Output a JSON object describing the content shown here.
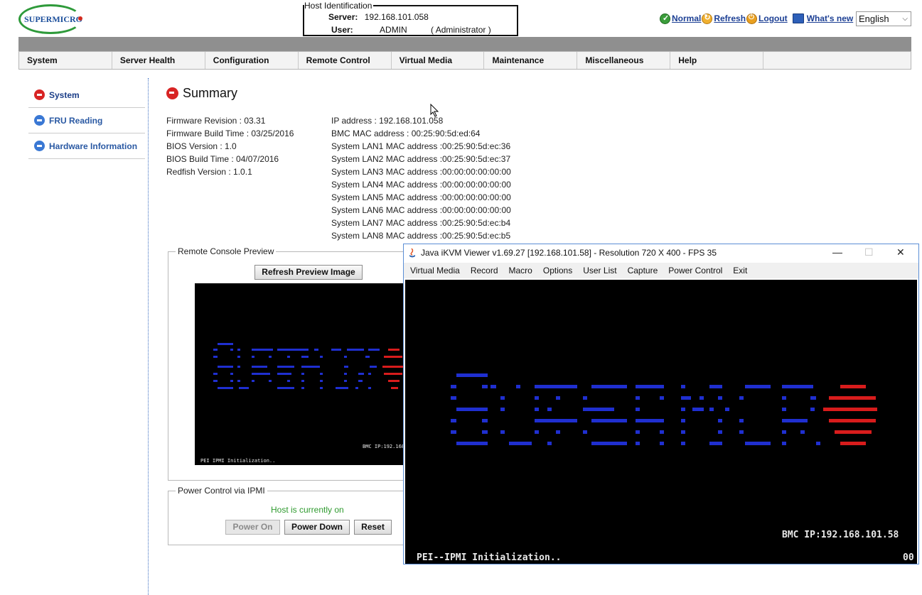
{
  "brand": {
    "logo_text": "SUPERMICRO"
  },
  "host_identification": {
    "legend": "Host Identification",
    "server_label": "Server:",
    "server_value": "192.168.101.058",
    "user_label": "User:",
    "user_value": "ADMIN",
    "user_role": "( Administrator )"
  },
  "status": {
    "normal": "Normal",
    "refresh": "Refresh",
    "logout": "Logout",
    "whats_new": "What's  new",
    "language": "English"
  },
  "nav": {
    "items": [
      "System",
      "Server Health",
      "Configuration",
      "Remote Control",
      "Virtual Media",
      "Maintenance",
      "Miscellaneous",
      "Help"
    ]
  },
  "sidebar": {
    "items": [
      {
        "label": "System",
        "active": true
      },
      {
        "label": "FRU Reading",
        "active": false
      },
      {
        "label": "Hardware Information",
        "active": false
      }
    ]
  },
  "summary": {
    "title": "Summary",
    "left_info": [
      "Firmware Revision :  03.31",
      "Firmware Build Time :  03/25/2016",
      "BIOS Version : 1.0",
      "BIOS Build Time : 04/07/2016",
      "Redfish Version : 1.0.1"
    ],
    "right_info": [
      "IP address :  192.168.101.058",
      "BMC MAC address :  00:25:90:5d:ed:64",
      "System LAN1 MAC address :00:25:90:5d:ec:36",
      "System LAN2 MAC address :00:25:90:5d:ec:37",
      "System LAN3 MAC address :00:00:00:00:00:00",
      "System LAN4 MAC address :00:00:00:00:00:00",
      "System LAN5 MAC address :00:00:00:00:00:00",
      "System LAN6 MAC address :00:00:00:00:00:00",
      "System LAN7 MAC address :00:25:90:5d:ec:b4",
      "System LAN8 MAC address :00:25:90:5d:ec:b5"
    ]
  },
  "remote_console": {
    "legend": "Remote Console Preview",
    "refresh_button": "Refresh Preview Image",
    "preview_bmc_ip": "BMC IP:192.168",
    "preview_status": "PEI  IPMI Initialization.."
  },
  "power_control": {
    "legend": "Power Control via IPMI",
    "host_status": "Host is currently on",
    "power_on": "Power On",
    "power_down": "Power Down",
    "reset": "Reset"
  },
  "kvm": {
    "title": "Java iKVM Viewer v1.69.27 [192.168.101.58]  - Resolution 720 X 400 - FPS 35",
    "menu": [
      "Virtual Media",
      "Record",
      "Macro",
      "Options",
      "User List",
      "Capture",
      "Power Control",
      "Exit"
    ],
    "bmc_ip": "BMC IP:192.168.101.58",
    "status_line": "PEI--IPMI Initialization..",
    "post_code": "00",
    "window_minimize": "—",
    "window_maximize": "☐",
    "window_close": "✕"
  },
  "colors": {
    "nav_bar": "#8f8f8f",
    "link_blue": "#1c3f94",
    "status_green": "#2e9a2e",
    "console_blue": "#1f2fd0",
    "console_red": "#d81c1c"
  }
}
